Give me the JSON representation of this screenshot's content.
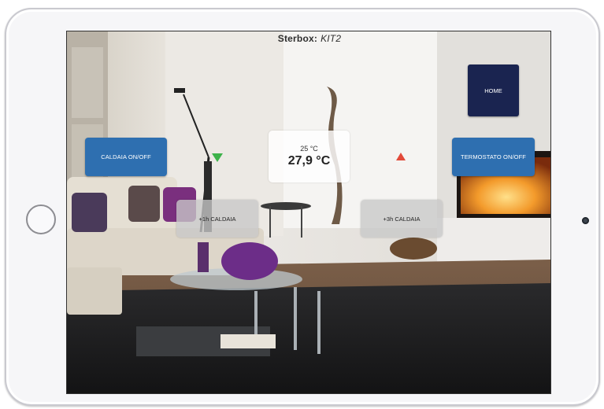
{
  "header": {
    "label": "Sterbox:",
    "device": "KIT2"
  },
  "buttons": {
    "home": "HOME",
    "boiler_toggle": "CALDAIA ON/OFF",
    "thermostat_toggle": "TERMOSTATO ON/OFF",
    "boost_1h": "+1h CALDAIA",
    "boost_3h": "+3h CALDAIA"
  },
  "thermostat": {
    "setpoint": "25 °C",
    "current": "27,9 °C"
  },
  "icons": {
    "decrease": "triangle-down-icon",
    "increase": "triangle-up-icon"
  },
  "colors": {
    "button_blue": "#2e6fb0",
    "home_navy": "#1a2450",
    "decrease_green": "#3db24a",
    "increase_red": "#e24a3a"
  }
}
